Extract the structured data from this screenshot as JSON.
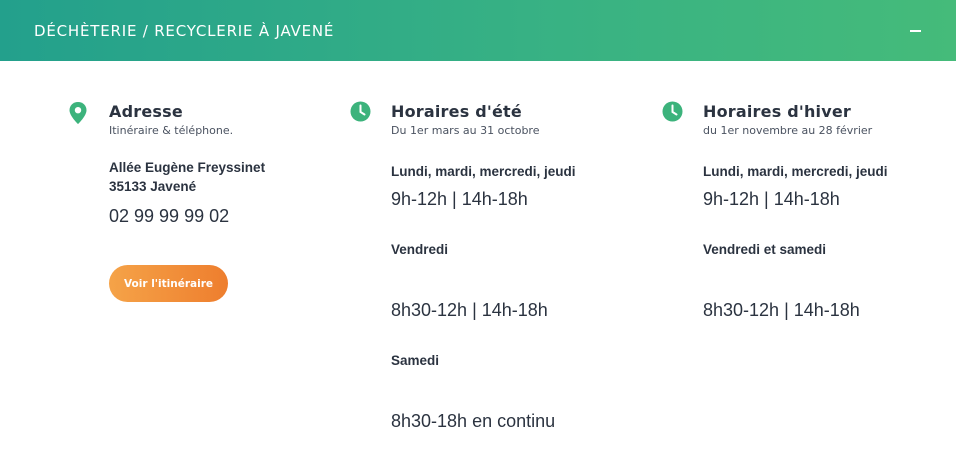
{
  "header": {
    "title": "DÉCHÈTERIE / RECYCLERIE À JAVENÉ",
    "toggle_icon": "minus-icon"
  },
  "colors": {
    "header_gradient_start": "#23a08c",
    "header_gradient_end": "#45bb7a",
    "icon_green": "#3cb37c",
    "button_gradient_start": "#f5a348",
    "button_gradient_end": "#ee7e2e"
  },
  "address": {
    "icon": "map-pin-icon",
    "title": "Adresse",
    "subtitle": "Itinéraire & téléphone.",
    "street": "Allée Eugène Freyssinet",
    "city": "35133 Javené",
    "phone": "02 99 99 99 02",
    "route_button": "Voir l'itinéraire"
  },
  "summer": {
    "icon": "clock-icon",
    "title": "Horaires d'été",
    "subtitle": "Du 1er mars au 31 octobre",
    "rows": [
      {
        "days": "Lundi, mardi, mercredi, jeudi",
        "hours": "9h-12h | 14h-18h"
      },
      {
        "days": "Vendredi",
        "hours": "8h30-12h | 14h-18h"
      },
      {
        "days": "Samedi",
        "hours": "8h30-18h en continu"
      }
    ]
  },
  "winter": {
    "icon": "clock-icon",
    "title": "Horaires d'hiver",
    "subtitle": "du 1er novembre au 28 février",
    "rows": [
      {
        "days": "Lundi, mardi, mercredi, jeudi",
        "hours": "9h-12h | 14h-18h"
      },
      {
        "days": "Vendredi et samedi",
        "hours": "8h30-12h | 14h-18h"
      }
    ]
  }
}
